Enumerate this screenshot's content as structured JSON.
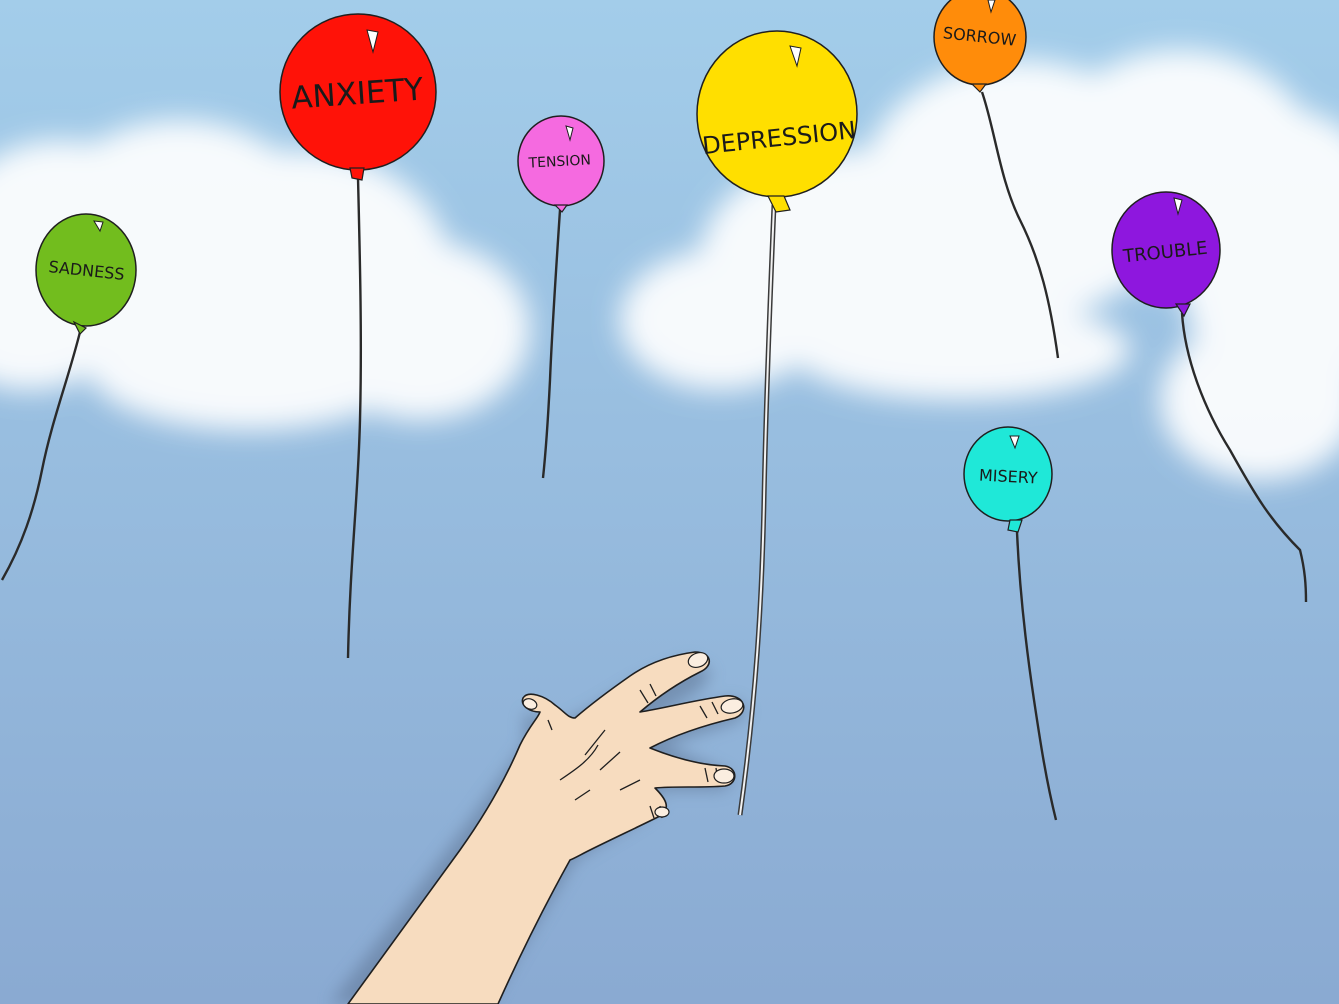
{
  "balloons": [
    {
      "id": "sadness",
      "label": "SADNESS",
      "color": "#72bd1e"
    },
    {
      "id": "anxiety",
      "label": "ANXIETY",
      "color": "#ff1208"
    },
    {
      "id": "tension",
      "label": "TENSION",
      "color": "#f56ae0"
    },
    {
      "id": "depression",
      "label": "DEPRESSION",
      "color": "#ffdf00"
    },
    {
      "id": "sorrow",
      "label": "SORROW",
      "color": "#ff8c0a"
    },
    {
      "id": "trouble",
      "label": "TROUBLE",
      "color": "#8e17de"
    },
    {
      "id": "misery",
      "label": "MISERY",
      "color": "#1fe8d8"
    }
  ],
  "colors": {
    "sky_top": "#a3cdea",
    "sky_bottom": "#8aaad2",
    "cloud": "#ffffff",
    "skin": "#f7dcbf",
    "outline": "#1f1f1f"
  }
}
